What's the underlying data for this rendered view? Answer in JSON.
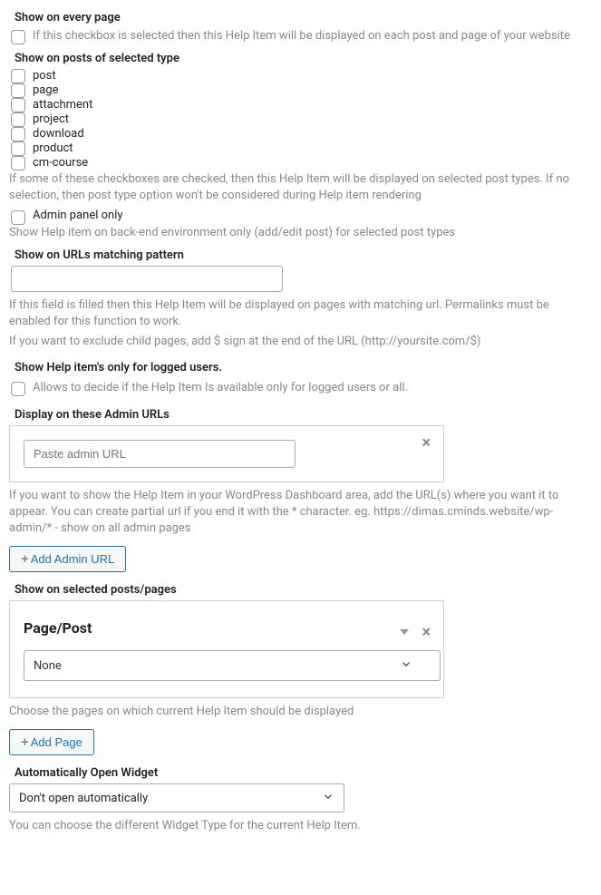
{
  "showEveryPage": {
    "title": "Show on every page",
    "desc": "If this checkbox is selected then this Help Item will be displayed on each post and page of your website"
  },
  "postTypes": {
    "title": "Show on posts of selected type",
    "items": [
      "post",
      "page",
      "attachment",
      "project",
      "download",
      "product",
      "cm-course"
    ],
    "desc": "If some of these checkboxes are checked, then this Help Item will be displayed on selected post types. If no selection, then post type option won't be considered during Help item rendering"
  },
  "adminOnly": {
    "label": "Admin panel only",
    "desc": "Show Help item on back-end environment only (add/edit post) for selected post types"
  },
  "urlPattern": {
    "title": "Show on URLs matching pattern",
    "desc1": "If this field is filled then this Help Item will be displayed on pages with matching url. Permalinks must be enabled for this function to work.",
    "desc2": "If you want to exclude child pages, add $ sign at the end of the URL (http://yoursite.com/$)"
  },
  "loggedUsers": {
    "title": "Show Help item's only for logged users.",
    "desc": "Allows to decide if the Help Item Is available only for logged users or all."
  },
  "adminUrls": {
    "title": "Display on these Admin URLs",
    "placeholder": "Paste admin URL",
    "desc": "If you want to show the Help Item in your WordPress Dashboard area, add the URL(s) where you want it to appear. You can create partial url if you end it with the * character. eg. https://dimas.cminds.website/wp-admin/* - show on all admin pages",
    "button": "Add Admin URL"
  },
  "selectedPosts": {
    "title": "Show on selected posts/pages",
    "boxTitle": "Page/Post",
    "selectValue": "None",
    "desc": "Choose the pages on which current Help Item should be displayed",
    "button": "Add Page"
  },
  "autoOpen": {
    "title": "Automatically Open Widget",
    "selectValue": "Don't open automatically",
    "desc": "You can choose the different Widget Type for the current Help Item."
  }
}
